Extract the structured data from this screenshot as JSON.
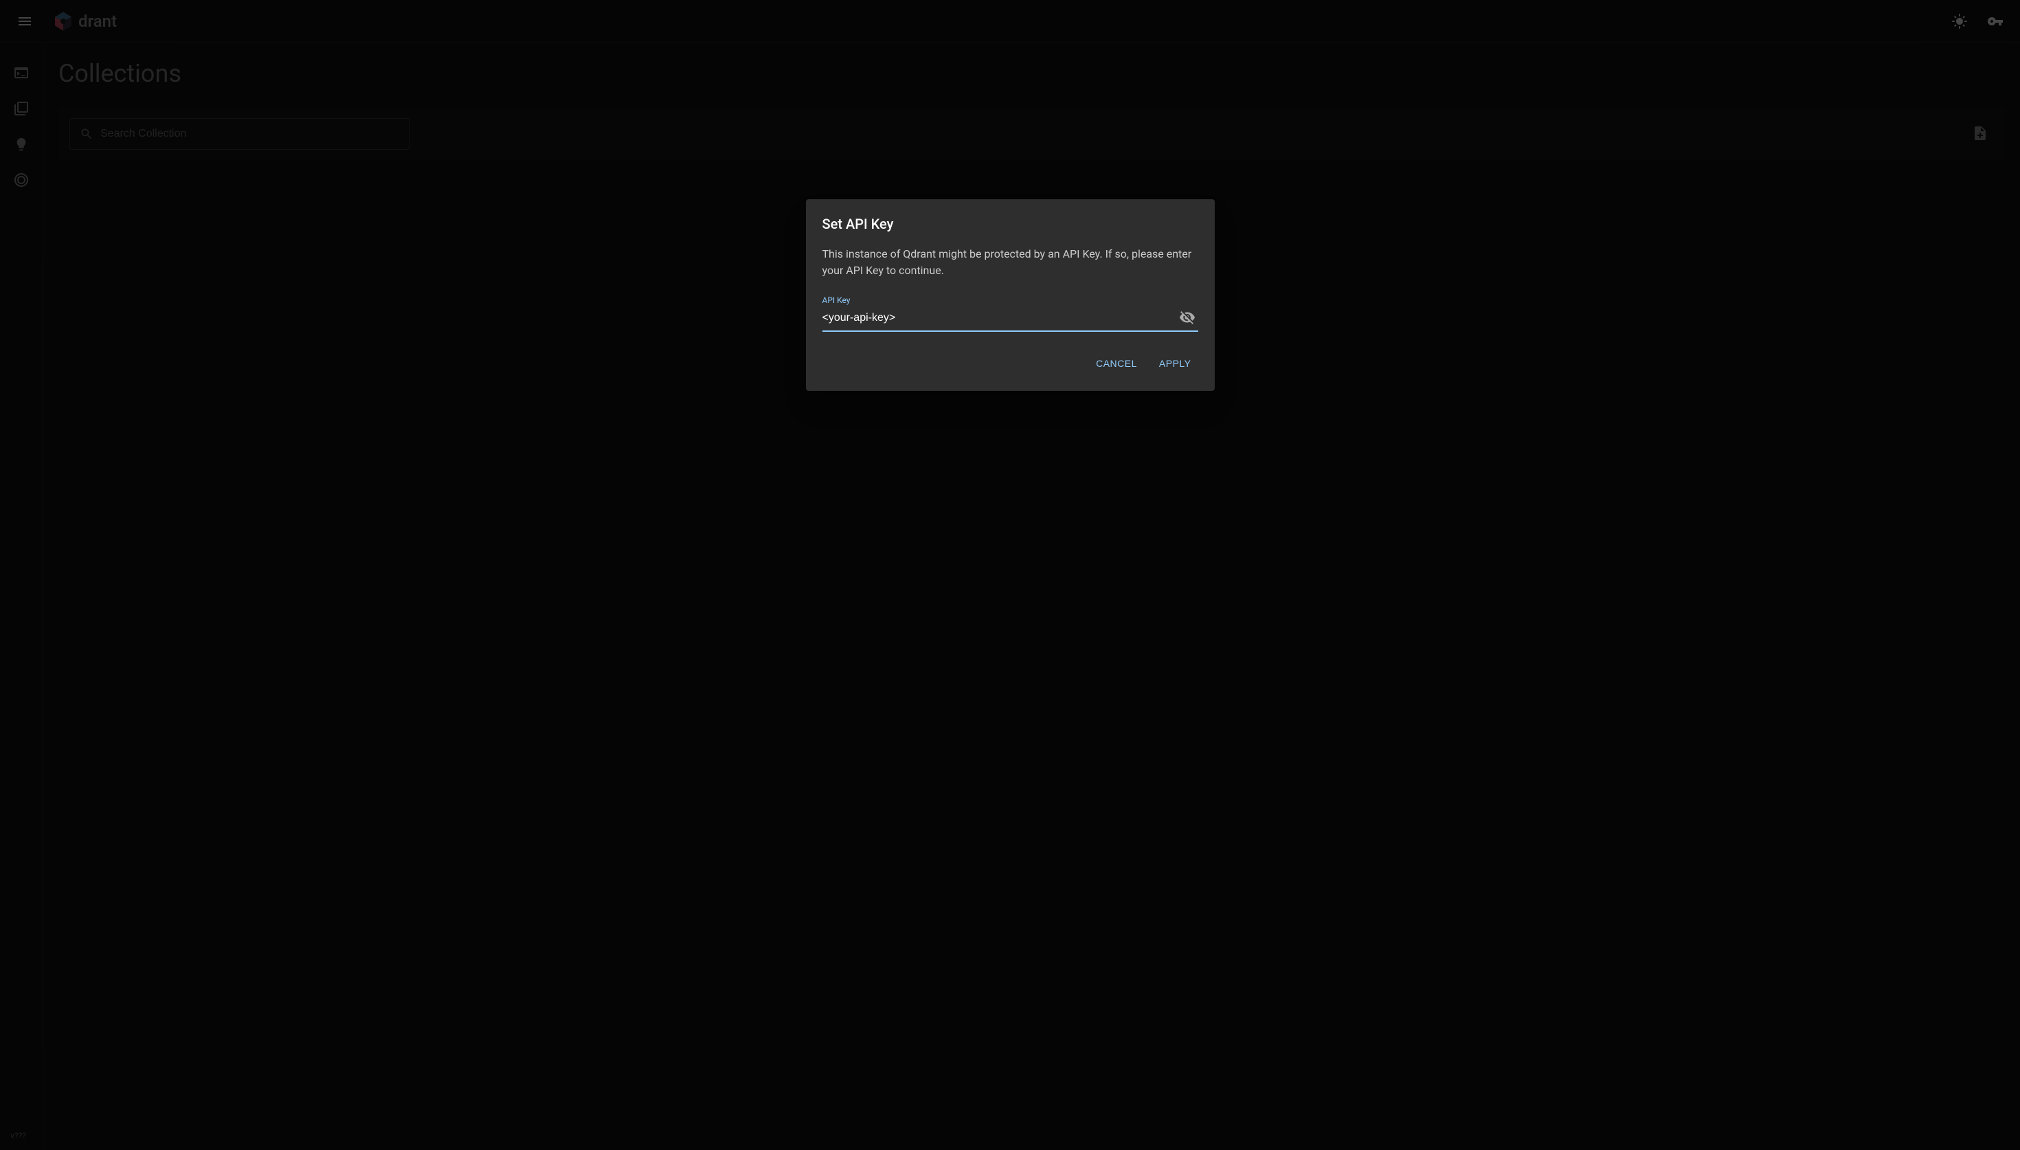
{
  "header": {
    "logo_text": "drant"
  },
  "sidebar": {
    "version": "v???"
  },
  "main": {
    "title": "Collections",
    "search_placeholder": "Search Collection"
  },
  "modal": {
    "title": "Set API Key",
    "description": "This instance of Qdrant might be protected by an API Key. If so, please enter your API Key to continue.",
    "input_label": "API Key",
    "input_value": "<your-api-key>",
    "cancel_label": "Cancel",
    "apply_label": "Apply"
  }
}
